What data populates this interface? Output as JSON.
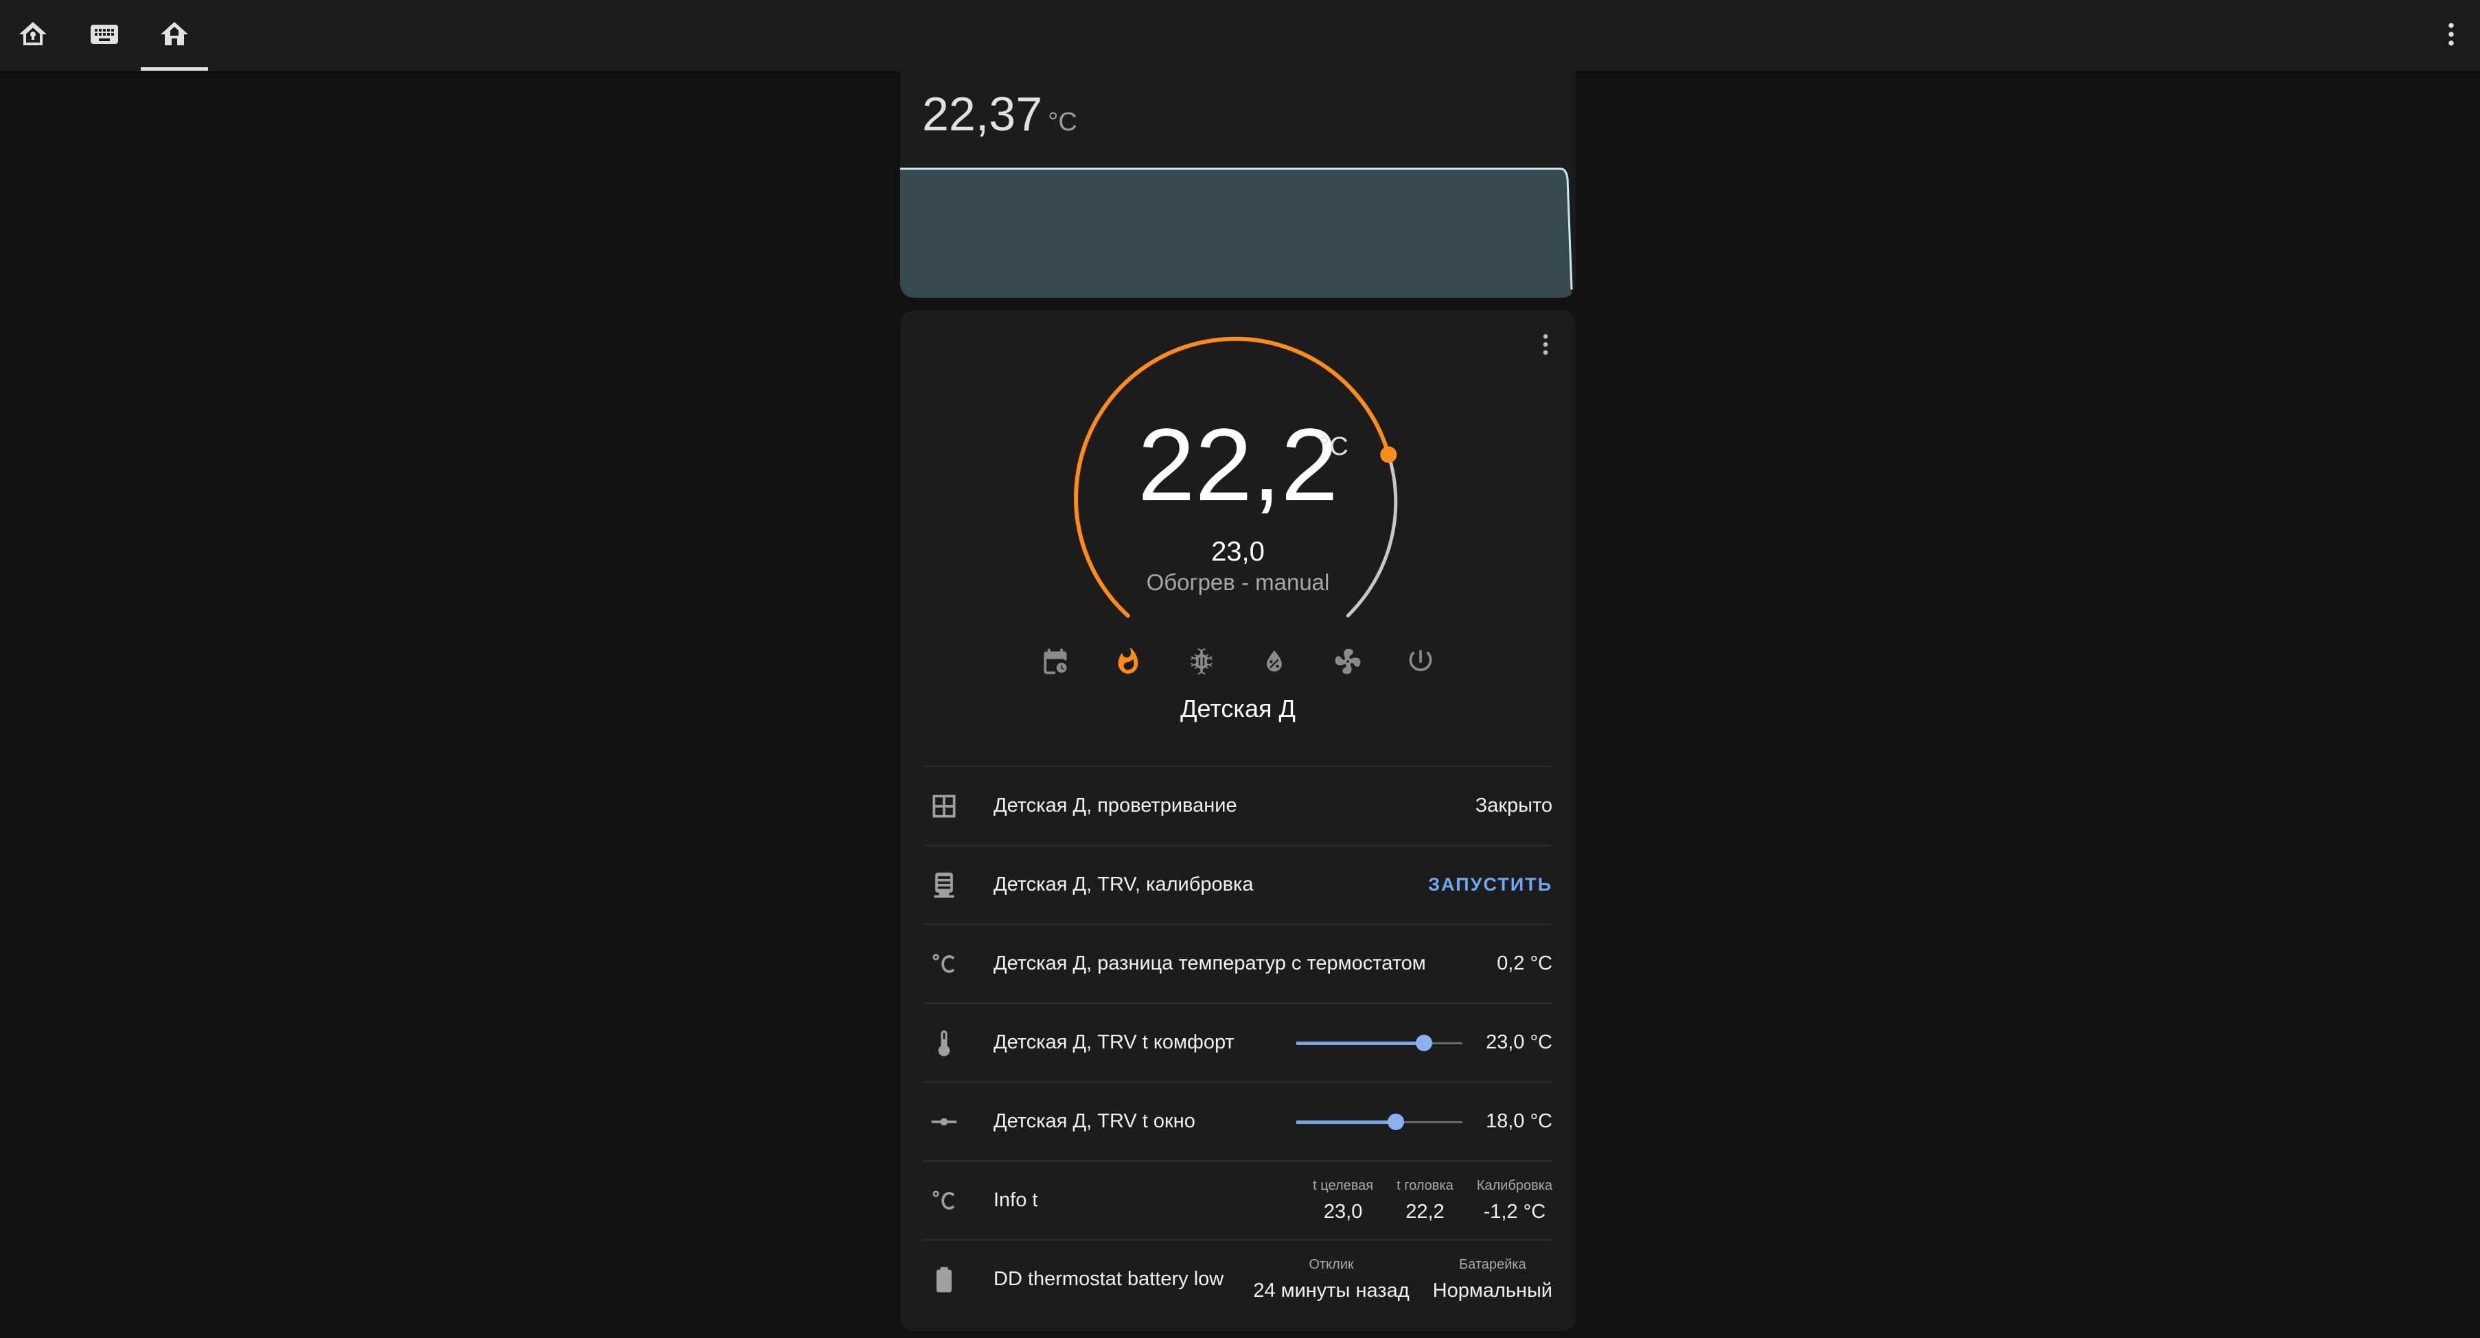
{
  "toolbar": {
    "tabs": [
      {
        "name": "home-assistant-icon"
      },
      {
        "name": "keyboard-icon"
      },
      {
        "name": "home-icon",
        "active": true
      }
    ],
    "menu_icon": "dots-vertical-icon"
  },
  "sensor_card": {
    "value": "22,37",
    "unit": "°C"
  },
  "thermostat": {
    "current_temperature": "22,2",
    "unit": "°C",
    "target_temperature": "23,0",
    "mode_label": "Обогрев - manual",
    "name": "Детская Д",
    "accent_color": "#ff8c1a",
    "modes": [
      {
        "name": "schedule-icon",
        "active": false
      },
      {
        "name": "fire-icon",
        "active": true
      },
      {
        "name": "snowflake-icon",
        "active": false
      },
      {
        "name": "water-percent-icon",
        "active": false
      },
      {
        "name": "fan-icon",
        "active": false
      },
      {
        "name": "power-icon",
        "active": false
      }
    ]
  },
  "rows": {
    "window": {
      "name": "Детская Д, проветривание",
      "value": "Закрыто",
      "icon": "window-icon"
    },
    "calibration": {
      "name": "Детская Д, TRV, калибровка",
      "action": "ЗАПУСТИТЬ",
      "icon": "radiator-icon"
    },
    "temp_diff": {
      "name": "Детская Д, разница температур с термостатом",
      "value": "0,2 °C",
      "icon": "celsius-icon"
    },
    "comfort": {
      "name": "Детская Д, TRV t комфорт",
      "value": "23,0 °C",
      "slider_fraction": 0.77,
      "icon": "thermometer-icon"
    },
    "window_temp": {
      "name": "Детская Д, TRV t окно",
      "value": "18,0 °C",
      "slider_fraction": 0.6,
      "icon": "ray-vertex-icon"
    },
    "info": {
      "name": "Info t",
      "icon": "celsius-icon",
      "attributes": [
        {
          "label": "t целевая",
          "value": "23,0"
        },
        {
          "label": "t головка",
          "value": "22,2"
        },
        {
          "label": "Калибровка",
          "value": "-1,2 °C"
        }
      ]
    },
    "battery": {
      "name": "DD thermostat battery low",
      "icon": "battery-icon",
      "attributes": [
        {
          "label": "Отклик",
          "value": "24 минуты назад"
        },
        {
          "label": "Батарейка",
          "value": "Нормальный"
        }
      ]
    }
  }
}
